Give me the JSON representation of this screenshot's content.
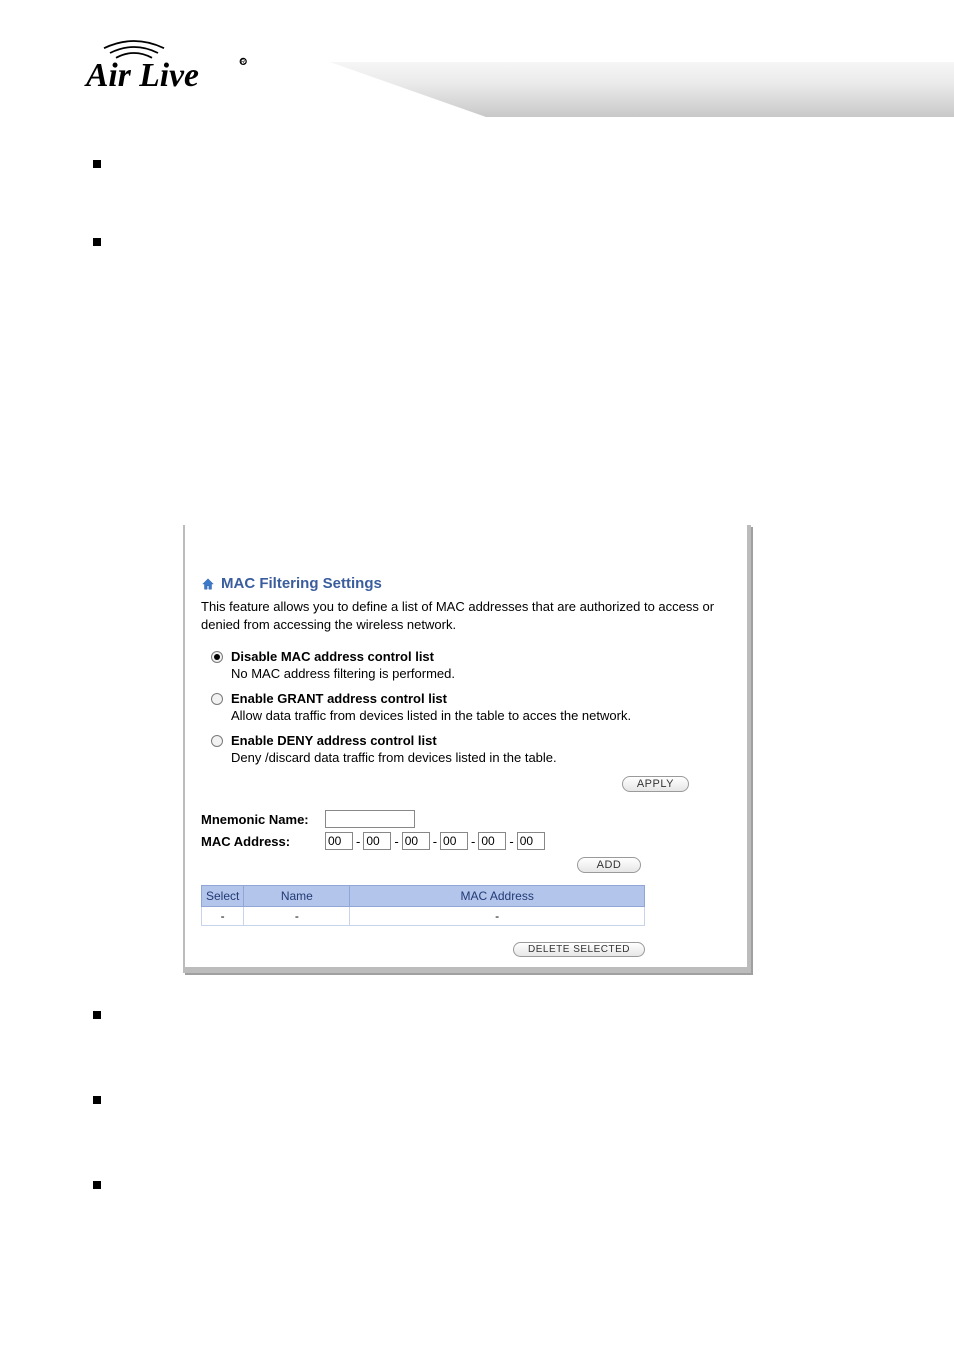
{
  "logo_text": "Air Live",
  "panel": {
    "title": "MAC Filtering Settings",
    "description": "This feature allows you to define a list of MAC addresses that are authorized to access or denied from accessing the wireless network.",
    "radios": {
      "disable": {
        "label": "Disable MAC address control list",
        "sub": "No MAC address filtering is performed."
      },
      "grant": {
        "label": "Enable GRANT address control list",
        "sub": "Allow data traffic from devices listed in the table to acces the network."
      },
      "deny": {
        "label": "Enable DENY address control list",
        "sub": "Deny /discard data traffic from devices listed in the table."
      }
    },
    "apply_label": "APPLY",
    "mnemonic_label": "Mnemonic Name:",
    "mac_label": "MAC Address:",
    "mac_octets": [
      "00",
      "00",
      "00",
      "00",
      "00",
      "00"
    ],
    "add_label": "ADD",
    "table": {
      "headers": [
        "Select",
        "Name",
        "MAC Address"
      ],
      "row": [
        "-",
        "-",
        "-"
      ]
    },
    "delete_label": "DELETE SELECTED"
  }
}
